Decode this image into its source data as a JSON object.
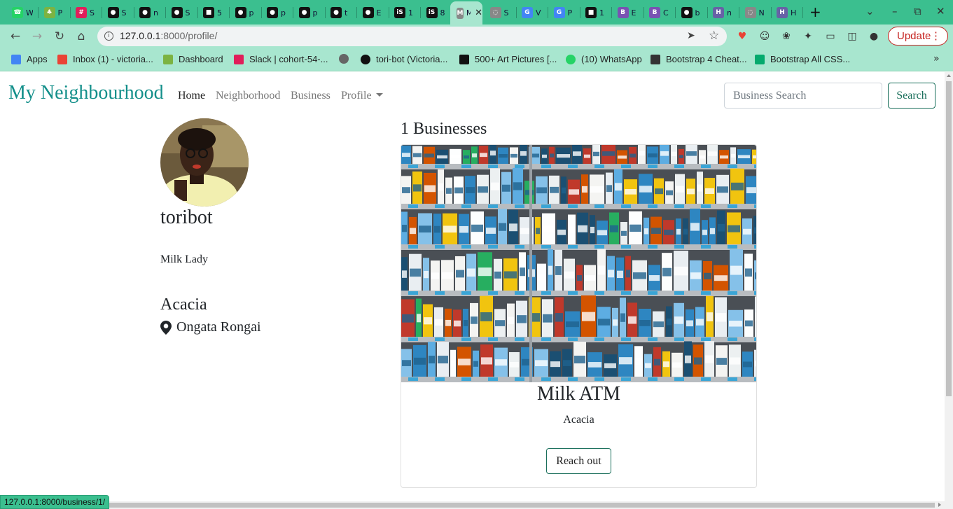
{
  "browser": {
    "tabs": [
      {
        "title": "W",
        "icon": "whatsapp-icon",
        "color": "#25d366"
      },
      {
        "title": "P",
        "icon": "palm-icon",
        "color": "#7cb342"
      },
      {
        "title": "S",
        "icon": "slack-icon",
        "color": "#e01e5a"
      },
      {
        "title": "S",
        "icon": "github-icon",
        "color": "#111111"
      },
      {
        "title": "n",
        "icon": "github-icon",
        "color": "#111111"
      },
      {
        "title": "S",
        "icon": "github-icon",
        "color": "#111111"
      },
      {
        "title": "5",
        "icon": "unsplash-icon",
        "color": "#111111"
      },
      {
        "title": "p",
        "icon": "github-icon",
        "color": "#111111"
      },
      {
        "title": "p",
        "icon": "github-icon",
        "color": "#111111"
      },
      {
        "title": "p",
        "icon": "github-icon",
        "color": "#111111"
      },
      {
        "title": "t",
        "icon": "github-icon",
        "color": "#111111"
      },
      {
        "title": "E",
        "icon": "github-icon",
        "color": "#111111"
      },
      {
        "title": "1",
        "icon": "is-icon",
        "color": "#111111"
      },
      {
        "title": "8",
        "icon": "is-icon",
        "color": "#111111"
      },
      {
        "title": "M",
        "icon": "page-icon",
        "color": "#888888",
        "active": true
      },
      {
        "title": "S",
        "icon": "globe-icon",
        "color": "#888888"
      },
      {
        "title": "V",
        "icon": "google-icon",
        "color": "#4285f4"
      },
      {
        "title": "P",
        "icon": "google-icon",
        "color": "#4285f4"
      },
      {
        "title": "1",
        "icon": "unsplash-icon",
        "color": "#111111"
      },
      {
        "title": "E",
        "icon": "bootstrap-icon",
        "color": "#7952b3"
      },
      {
        "title": "C",
        "icon": "bootstrap-icon",
        "color": "#7952b3"
      },
      {
        "title": "b",
        "icon": "github-icon",
        "color": "#111111"
      },
      {
        "title": "n",
        "icon": "heroku-icon",
        "color": "#6762a6"
      },
      {
        "title": "N",
        "icon": "globe-icon",
        "color": "#888888"
      },
      {
        "title": "H",
        "icon": "heroku-icon",
        "color": "#6762a6"
      }
    ],
    "url_host": "127.0.0.1",
    "url_path": ":8000/profile/",
    "update_label": "Update",
    "bookmarks": [
      {
        "label": "Apps",
        "icon": "apps-grid-icon",
        "color": "#4285f4"
      },
      {
        "label": "Inbox (1) - victoria...",
        "icon": "gmail-icon",
        "color": "#ea4335"
      },
      {
        "label": "Dashboard",
        "icon": "palm-icon",
        "color": "#7cb342"
      },
      {
        "label": "Slack | cohort-54-...",
        "icon": "slack-icon",
        "color": "#e01e5a"
      },
      {
        "label": "",
        "icon": "globe-icon",
        "color": "#666666"
      },
      {
        "label": "tori-bot (Victoria...",
        "icon": "github-icon",
        "color": "#111111"
      },
      {
        "label": "500+ Art Pictures [...",
        "icon": "unsplash-icon",
        "color": "#111111"
      },
      {
        "label": "(10) WhatsApp",
        "icon": "whatsapp-icon",
        "color": "#25d366"
      },
      {
        "label": "Bootstrap 4 Cheat...",
        "icon": "bootstrap-icon",
        "color": "#333333"
      },
      {
        "label": "Bootstrap All CSS...",
        "icon": "w3-icon",
        "color": "#04aa6d"
      }
    ],
    "status_url": "127.0.0.1:8000/business/1/"
  },
  "navbar": {
    "brand": "My Neighbourhood",
    "links": [
      "Home",
      "Neighborhood",
      "Business",
      "Profile"
    ],
    "search_placeholder": "Business Search",
    "search_button": "Search",
    "accent": "#138f8a"
  },
  "profile": {
    "username": "toribot",
    "bio": "Milk Lady",
    "neighbourhood": "Acacia",
    "location": "Ongata Rongai"
  },
  "businesses": {
    "count_label": "1 Businesses",
    "items": [
      {
        "name": "Milk ATM",
        "neighbourhood": "Acacia",
        "button": "Reach out"
      }
    ]
  }
}
